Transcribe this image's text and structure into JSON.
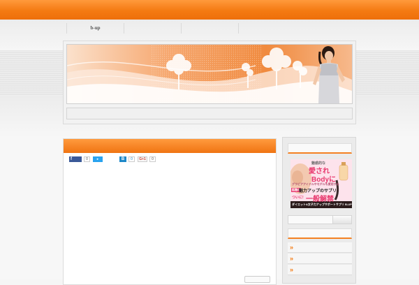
{
  "header": {
    "nav": [
      {
        "label": "b-up"
      },
      {
        "label": ""
      },
      {
        "label": ""
      },
      {
        "label": ""
      }
    ]
  },
  "share": {
    "facebook_count": "0",
    "hatena_count": "0",
    "gplus_label": "G+1",
    "gplus_count": "0"
  },
  "sidebar": {
    "ad": {
      "tagline": "魅惑的な",
      "headline_1": "愛され",
      "headline_2": "Bodyに",
      "sub": "グラビアアイドルやモデルも愛用する",
      "line_1": "魅力アップのサプリ",
      "badge": "話題の",
      "line_2": "ついに!",
      "line_3": "一般解禁",
      "footer": "ダイエット&女子力アップサポートサプリ B-UP"
    },
    "link_arrows": [
      "»",
      "»",
      "»"
    ]
  },
  "colors": {
    "accent": "#f47a12",
    "facebook": "#3b5998",
    "twitter": "#2aa3ef",
    "hatena": "#1e88c8"
  },
  "icons": [
    "facebook-icon",
    "twitter-icon",
    "hatena-bookmark-icon",
    "google-plus-icon",
    "arrow-right-icon"
  ]
}
